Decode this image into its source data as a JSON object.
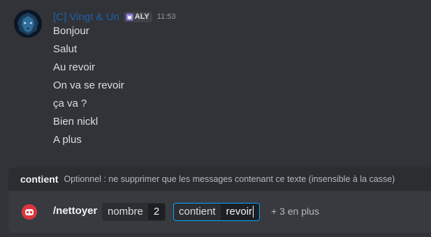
{
  "message": {
    "username": "[C] Vingt & Un",
    "tag": "ALY",
    "timestamp": "11:53",
    "lines": [
      "Bonjour",
      "Salut",
      "Au revoir",
      "On va se revoir",
      "ça va ?",
      "Bien nickl",
      "A plus"
    ]
  },
  "option_hint": {
    "name": "contient",
    "description": "Optionnel : ne supprimer que les messages contenant ce texte (insensible à la casse)"
  },
  "command": {
    "name": "/nettoyer",
    "options": [
      {
        "label": "nombre",
        "value": "2"
      },
      {
        "label": "contient",
        "value": "revoir"
      }
    ],
    "more": "+ 3 en plus"
  },
  "colors": {
    "username": "#1f5fa8",
    "active_border": "#00a8fc",
    "app_icon": "#da373c"
  },
  "icons": {
    "avatar": "lion-avatar",
    "tag": "tag-icon",
    "app": "bot-app-icon"
  }
}
